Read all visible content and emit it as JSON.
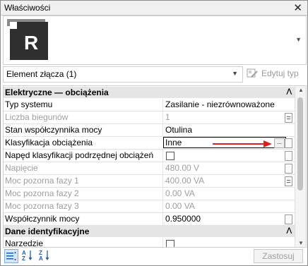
{
  "window": {
    "title": "Właściwości",
    "close": "✕"
  },
  "type_selector": {
    "logo_letter": "R",
    "dropdown": "▼"
  },
  "selection": {
    "label": "Element złącza (1)",
    "arrow": "▼",
    "edit_type": "Edytuj typ"
  },
  "sections": [
    {
      "title": "Elektryczne — obciążenia",
      "chevron": "⋀",
      "rows": [
        {
          "name": "Typ systemu",
          "value": "Zasilanie - niezrównoważone",
          "disabled": false
        },
        {
          "name": "Liczba biegunów",
          "value": "1",
          "disabled": true
        },
        {
          "name": "Stan współczynnika mocy",
          "value": "Otulina",
          "disabled": false
        },
        {
          "name": "Klasyfikacja obciążenia",
          "value": "Inne",
          "disabled": false,
          "editing": true,
          "button": "..."
        },
        {
          "name": "Napęd klasyfikacji podrzędnej obciążeń",
          "checkbox": true,
          "disabled": false
        },
        {
          "name": "Napięcie",
          "value": "480.00 V",
          "disabled": true
        },
        {
          "name": "Moc pozorna fazy 1",
          "value": "400.00 VA",
          "disabled": true
        },
        {
          "name": "Moc pozorna fazy 2",
          "value": "0.00 VA",
          "disabled": true
        },
        {
          "name": "Moc pozorna fazy 3",
          "value": "0.00 VA",
          "disabled": true
        },
        {
          "name": "Współczynnik mocy",
          "value": "0.950000",
          "disabled": false
        }
      ]
    },
    {
      "title": "Dane identyfikacyjne",
      "chevron": "⋀",
      "rows": [
        {
          "name": "Narzedzie",
          "checkbox": true,
          "disabled": false
        }
      ]
    }
  ],
  "scrollbar": {
    "up": "▲",
    "down": "▼"
  },
  "footer": {
    "apply": "Zastosuj"
  },
  "colors": {
    "accent": "#e0201c",
    "revit_logo": "#2b2b2b",
    "section_bg": "#e5e5e5"
  }
}
